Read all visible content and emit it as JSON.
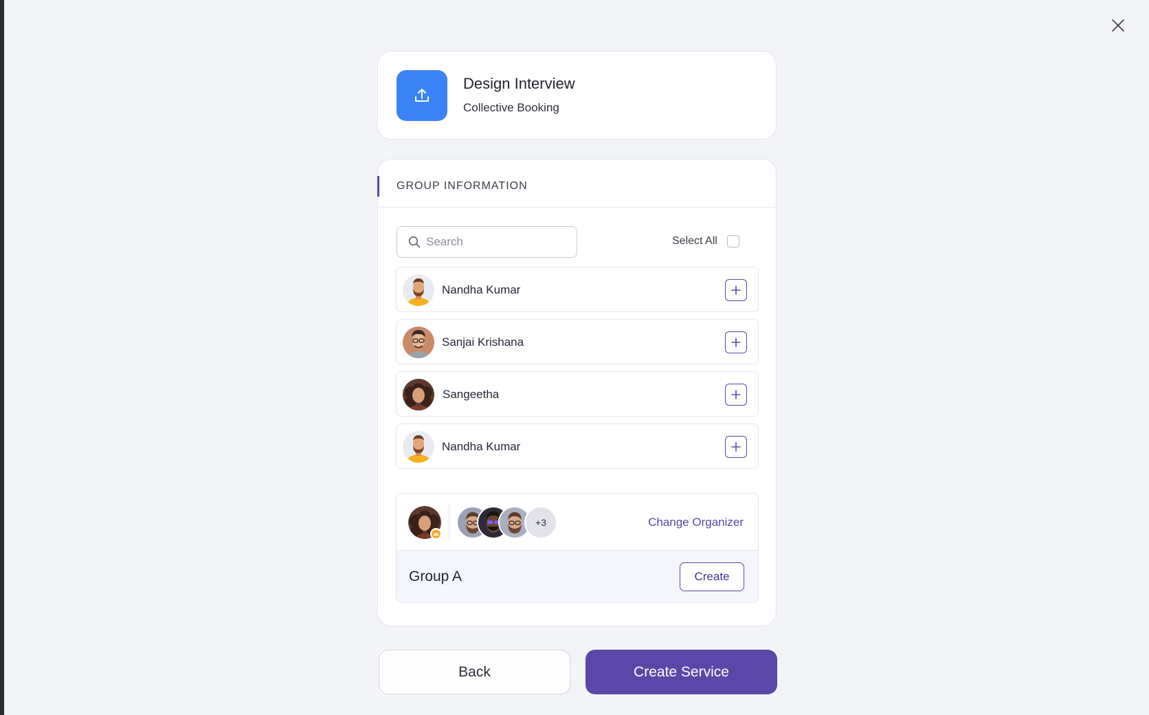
{
  "service": {
    "title": "Design Interview",
    "subtitle": "Collective Booking",
    "icon": "upload-icon",
    "icon_color": "#3b82f6"
  },
  "group_info": {
    "heading": "GROUP INFORMATION",
    "search_placeholder": "Search",
    "search_value": "",
    "select_all_label": "Select All",
    "select_all_checked": false
  },
  "members": [
    {
      "name": "Nandha Kumar",
      "avatar": "avatar-man-beard-yellow"
    },
    {
      "name": "Sanjai Krishana",
      "avatar": "avatar-man-glasses"
    },
    {
      "name": "Sangeetha",
      "avatar": "avatar-woman-curly"
    },
    {
      "name": "Nandha Kumar",
      "avatar": "avatar-man-beard-yellow"
    }
  ],
  "group": {
    "name": "Group A",
    "more_count": "+3",
    "change_organizer_label": "Change Organizer",
    "create_label": "Create"
  },
  "footer": {
    "back_label": "Back",
    "create_service_label": "Create Service"
  },
  "colors": {
    "accent": "#5b47a8",
    "background": "#f3f4f8",
    "icon_blue": "#3b82f6"
  }
}
